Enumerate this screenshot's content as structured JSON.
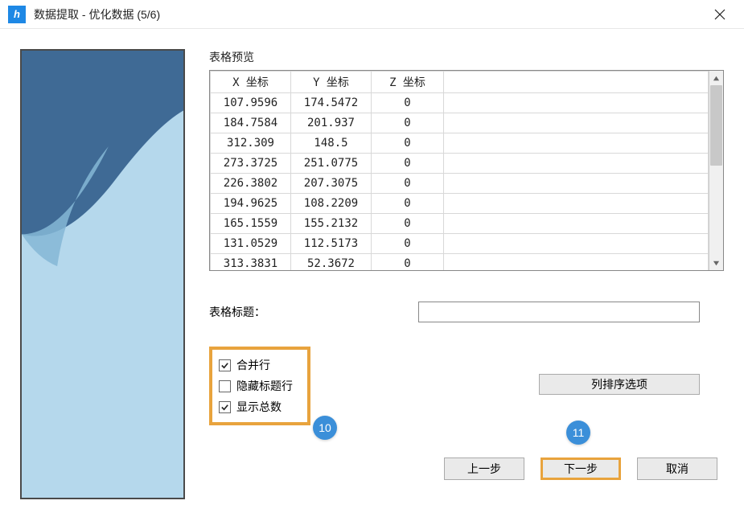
{
  "window": {
    "title": "数据提取 - 优化数据 (5/6)"
  },
  "preview_label": "表格预览",
  "table": {
    "headers": {
      "x": "X 坐标",
      "y": "Y 坐标",
      "z": "Z 坐标"
    },
    "rows": [
      {
        "x": "107.9596",
        "y": "174.5472",
        "z": "0"
      },
      {
        "x": "184.7584",
        "y": "201.937",
        "z": "0"
      },
      {
        "x": "312.309",
        "y": "148.5",
        "z": "0"
      },
      {
        "x": "273.3725",
        "y": "251.0775",
        "z": "0"
      },
      {
        "x": "226.3802",
        "y": "207.3075",
        "z": "0"
      },
      {
        "x": "194.9625",
        "y": "108.2209",
        "z": "0"
      },
      {
        "x": "165.1559",
        "y": "155.2132",
        "z": "0"
      },
      {
        "x": "131.0529",
        "y": "112.5173",
        "z": "0"
      },
      {
        "x": "313.3831",
        "y": "52.3672",
        "z": "0"
      }
    ]
  },
  "table_title": {
    "label": "表格标题：",
    "value": ""
  },
  "options": {
    "merge_rows": {
      "label": "合并行",
      "checked": true
    },
    "hide_header": {
      "label": "隐藏标题行",
      "checked": false
    },
    "show_total": {
      "label": "显示总数",
      "checked": true
    }
  },
  "sort_button": "列排序选项",
  "buttons": {
    "prev": "上一步",
    "next": "下一步",
    "cancel": "取消"
  },
  "callouts": {
    "c10": "10",
    "c11": "11"
  }
}
